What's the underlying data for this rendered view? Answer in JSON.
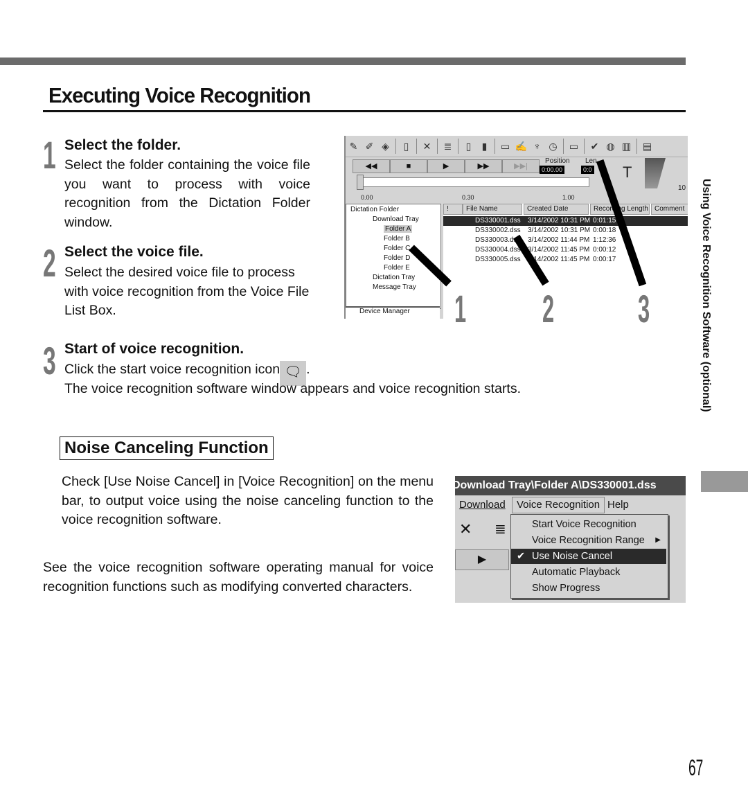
{
  "header": {
    "title": "Executing Voice Recognition"
  },
  "steps": [
    {
      "number": "1",
      "heading": "Select the folder.",
      "text": "Select the folder containing the voice file you want to process with voice recognition from the Dictation Folder window."
    },
    {
      "number": "2",
      "heading": "Select the voice file.",
      "text": "Select the desired voice file to process with voice recognition from the Voice File List Box."
    },
    {
      "number": "3",
      "heading": "Start of voice recognition.",
      "text_before_icon": "Click the start voice recognition icon",
      "text_after_icon": ".",
      "text2": "The voice recognition software window appears and voice recognition starts."
    }
  ],
  "noise_section": {
    "title": "Noise Canceling Function",
    "paragraph1": "Check [Use Noise Cancel] in [Voice Recognition] on the menu bar, to output voice using the noise canceling function to the voice recognition software.",
    "paragraph2": "See the voice recognition software operating manual for voice recognition functions such as modifying converted characters."
  },
  "side_label": "Using Voice Recognition Software (optional)",
  "page_number": "67",
  "screenshot1": {
    "transport": [
      "◀◀",
      "■",
      "▶",
      "▶▶",
      "▶▶|"
    ],
    "position_label": "Position",
    "position_value": "0:00.00",
    "length_label": "Len",
    "length_value": "0:0",
    "volume_label": "10",
    "ruler": [
      "0.00",
      "0.30",
      "1.00"
    ],
    "tree": [
      "Dictation Folder",
      "Download Tray",
      "Folder A",
      "Folder B",
      "Folder C",
      "Folder D",
      "Folder E",
      "Dictation Tray",
      "Message Tray"
    ],
    "device_manager": "Device Manager",
    "columns": [
      "!",
      "File Name",
      "Created Date",
      "Recording Length",
      "Comment"
    ],
    "files": [
      {
        "name": "DS330001.dss",
        "date": "3/14/2002 10:31 PM",
        "length": "0:01:15"
      },
      {
        "name": "DS330002.dss",
        "date": "3/14/2002 10:31 PM",
        "length": "0:00:18"
      },
      {
        "name": "DS330003.dss",
        "date": "3/14/2002 11:44 PM",
        "length": "1:12:36"
      },
      {
        "name": "DS330004.dss",
        "date": "3/14/2002 11:45 PM",
        "length": "0:00:12"
      },
      {
        "name": "DS330005.dss",
        "date": "3/14/2002 11:45 PM",
        "length": "0:00:17"
      }
    ],
    "callouts": [
      "1",
      "2",
      "3"
    ]
  },
  "screenshot2": {
    "title": "Download Tray\\Folder A\\DS330001.dss",
    "menubar": [
      "Download",
      "Voice Recognition",
      "Help"
    ],
    "menu_items": [
      {
        "label": "Start Voice Recognition",
        "checked": false,
        "submenu": false
      },
      {
        "label": "Voice Recognition Range",
        "checked": false,
        "submenu": true
      },
      {
        "label": "Use Noise Cancel",
        "checked": true,
        "submenu": false
      },
      {
        "label": "Automatic Playback",
        "checked": false,
        "submenu": false
      },
      {
        "label": "Show Progress",
        "checked": false,
        "submenu": false
      }
    ],
    "check_glyph": "✔",
    "submenu_glyph": "▶"
  }
}
